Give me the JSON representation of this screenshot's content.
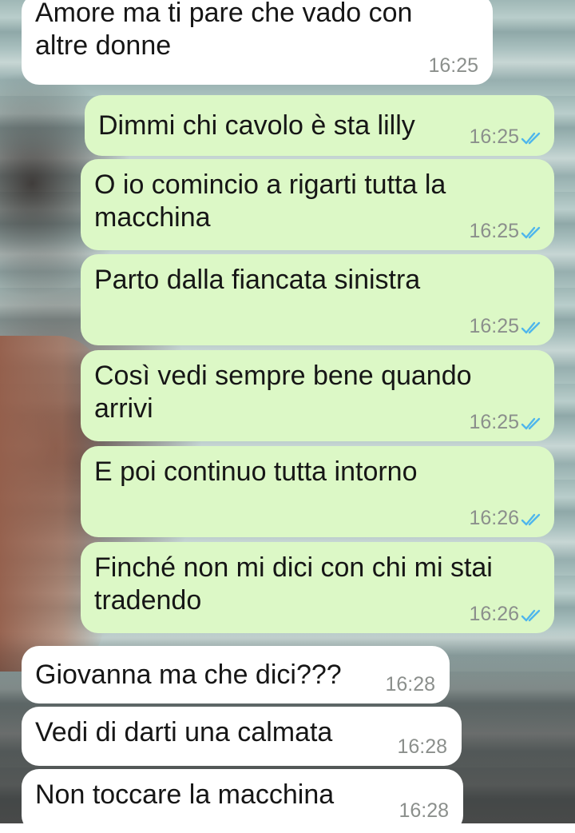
{
  "messages": [
    {
      "dir": "in",
      "text": "Amore ma ti pare che vado con\naltre donne",
      "time": "16:25"
    },
    {
      "dir": "out",
      "text": "Dimmi chi cavolo è sta lilly",
      "time": "16:25",
      "status": "read"
    },
    {
      "dir": "out",
      "text": "O io comincio a rigarti tutta la\nmacchina",
      "time": "16:25",
      "status": "read"
    },
    {
      "dir": "out",
      "text": "Parto dalla fiancata sinistra",
      "time": "16:25",
      "status": "read"
    },
    {
      "dir": "out",
      "text": "Così vedi sempre bene quando\narrivi",
      "time": "16:25",
      "status": "read"
    },
    {
      "dir": "out",
      "text": "E poi continuo tutta intorno",
      "time": "16:26",
      "status": "read"
    },
    {
      "dir": "out",
      "text": "Finché non mi dici con chi mi stai\ntradendo",
      "time": "16:26",
      "status": "read"
    },
    {
      "dir": "in",
      "text": "Giovanna ma che dici???",
      "time": "16:28"
    },
    {
      "dir": "in",
      "text": "Vedi di darti una calmata",
      "time": "16:28"
    },
    {
      "dir": "in",
      "text": "Non toccare la macchina",
      "time": "16:28"
    }
  ],
  "icons": {
    "read_receipt": "double-check-icon"
  },
  "colors": {
    "incoming_bubble": "#ffffff",
    "outgoing_bubble": "#dcf8c6",
    "read_tick": "#4fb6ec",
    "timestamp": "#8b8f8c"
  }
}
